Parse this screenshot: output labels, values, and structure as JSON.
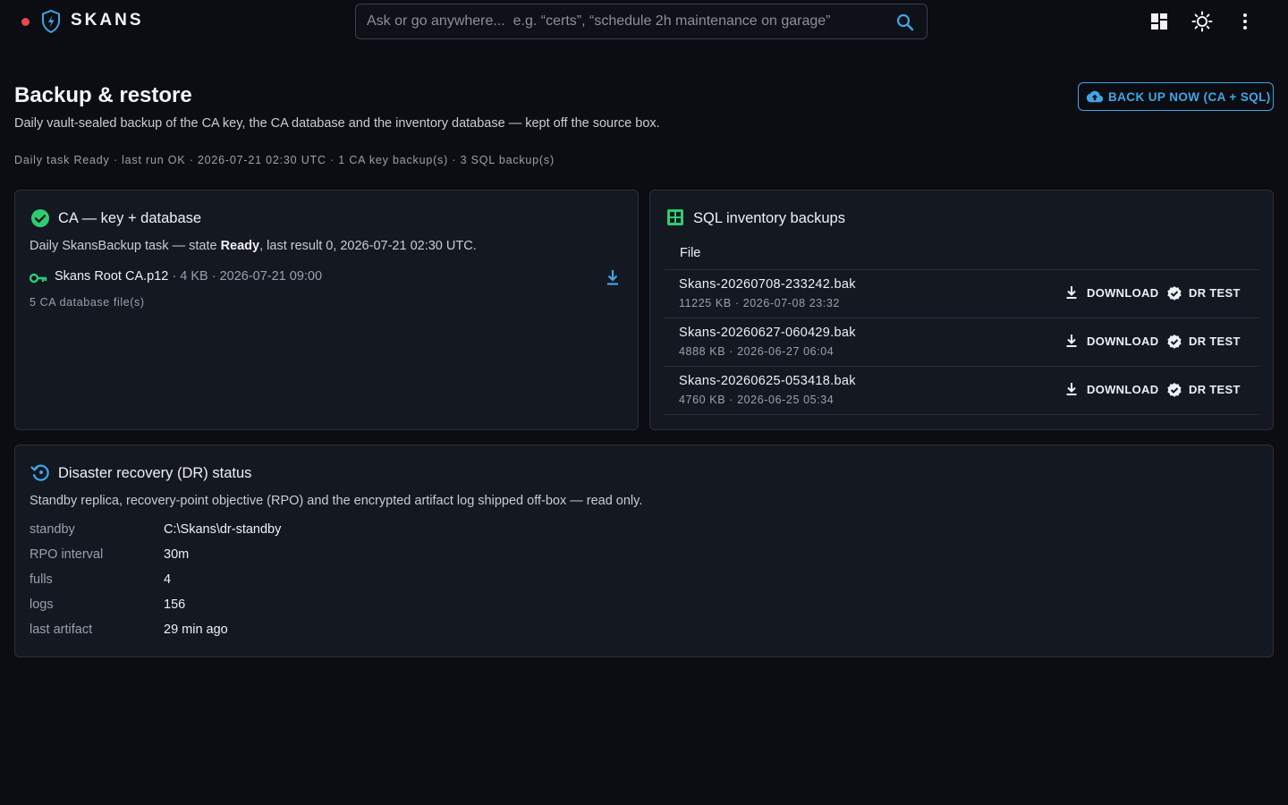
{
  "app": {
    "brand": "SKANS",
    "search_placeholder": "Ask or go anywhere...  e.g. “certs”, “schedule 2h maintenance on garage”"
  },
  "header": {
    "title": "Backup & restore",
    "subtitle": "Daily vault-sealed backup of the CA key, the CA database and the inventory database — kept off the source box.",
    "task_line": "Daily task Ready · last run OK · 2026-07-21 02:30 UTC · 1 CA key backup(s) · 3 SQL backup(s)",
    "backup_button": "BACK UP NOW (CA + SQL)"
  },
  "ca_card": {
    "title": "CA — key + database",
    "desc_prefix": "Daily SkansBackup task — state ",
    "desc_state": "Ready",
    "desc_suffix": ", last result 0, 2026-07-21 02:30 UTC.",
    "file_name": "Skans Root CA.p12",
    "file_meta": " · 4 KB · 2026-07-21 09:00",
    "db_count": "5 CA database file(s)"
  },
  "sql_card": {
    "title": "SQL inventory backups",
    "column_file": "File",
    "download_label": "DOWNLOAD",
    "dr_test_label": "DR TEST",
    "rows": [
      {
        "name": "Skans-20260708-233242.bak",
        "meta": "11225 KB · 2026-07-08 23:32"
      },
      {
        "name": "Skans-20260627-060429.bak",
        "meta": "4888 KB · 2026-06-27 06:04"
      },
      {
        "name": "Skans-20260625-053418.bak",
        "meta": "4760 KB · 2026-06-25 05:34"
      }
    ]
  },
  "dr_card": {
    "title": "Disaster recovery (DR) status",
    "desc": "Standby replica, recovery-point objective (RPO) and the encrypted artifact log shipped off-box — read only.",
    "fields": [
      {
        "key": "standby",
        "value": "C:\\Skans\\dr-standby"
      },
      {
        "key": "RPO interval",
        "value": "30m"
      },
      {
        "key": "fulls",
        "value": "4"
      },
      {
        "key": "logs",
        "value": "156"
      },
      {
        "key": "last artifact",
        "value": "29 min ago"
      }
    ]
  },
  "colors": {
    "background": "#0b0d12",
    "card": "#141821",
    "accent_blue": "#3fa6e6",
    "success_green": "#2ecc71",
    "status_red": "#e5484d"
  },
  "icons": {
    "status": "status-dot",
    "logo": "shield-bolt-icon",
    "search": "search-icon",
    "dashboard": "dashboard-icon",
    "theme": "sun-icon",
    "menu": "more-vert-icon",
    "cloud_upload": "cloud-upload-icon",
    "ca_status": "check-circle-icon",
    "key": "key-icon",
    "download": "download-icon",
    "table": "table-icon",
    "verified": "verified-icon",
    "dr": "restore-icon"
  }
}
